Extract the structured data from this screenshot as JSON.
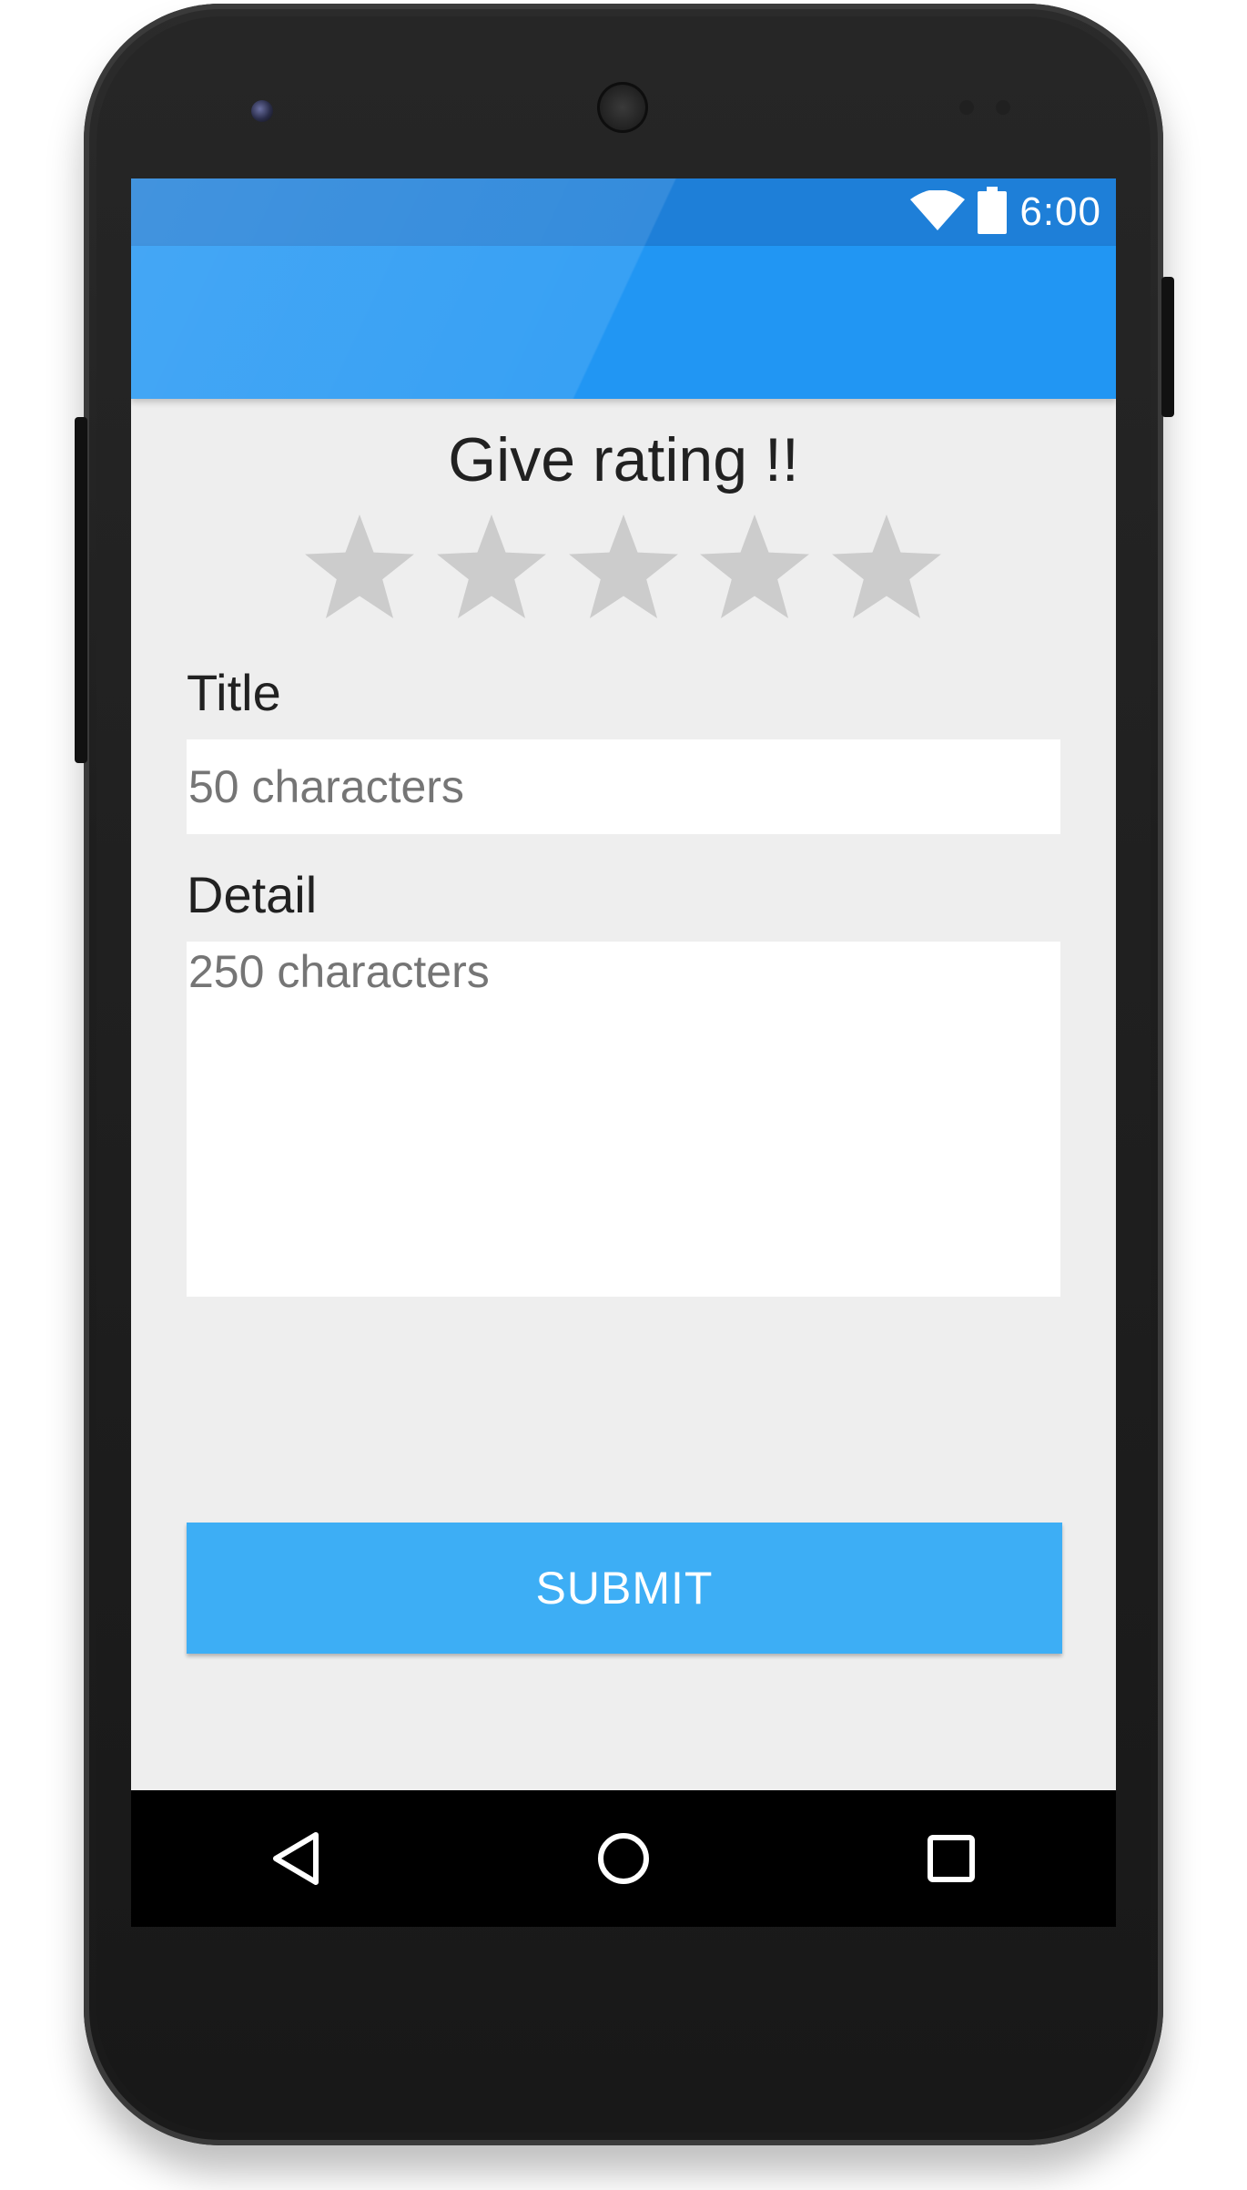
{
  "status_bar": {
    "time": "6:00",
    "icons": [
      "wifi-icon",
      "battery-icon"
    ]
  },
  "rating": {
    "title": "Give rating !!",
    "max_stars": 5,
    "selected_stars": 0
  },
  "title_field": {
    "label": "Title",
    "placeholder": "50 characters",
    "value": ""
  },
  "detail_field": {
    "label": "Detail",
    "placeholder": "250 characters",
    "value": ""
  },
  "submit": {
    "label": "SUBMIT"
  },
  "nav_bar": {
    "buttons": [
      "back-icon",
      "home-icon",
      "recents-icon"
    ]
  },
  "colors": {
    "status_bar": "#1e7fd8",
    "app_bar": "#2196f3",
    "background": "#eeeeee",
    "star_empty": "#cccccc",
    "submit_button": "#3daef5",
    "nav_bar": "#000000"
  }
}
